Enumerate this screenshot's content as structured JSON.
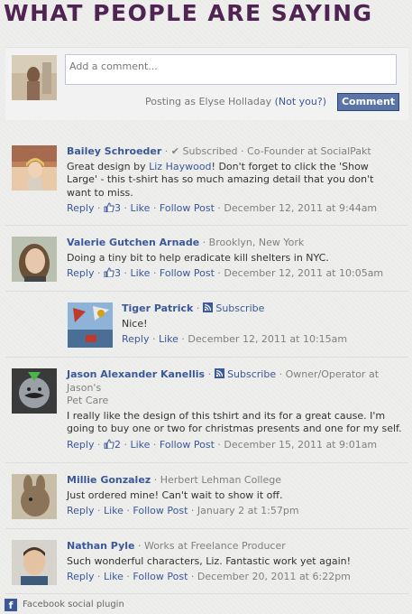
{
  "heading": "WHAT PEOPLE ARE SAYING",
  "composer": {
    "placeholder": "Add a comment...",
    "posting_as": "Posting as Elyse Holladay",
    "not_you": "(Not you?)",
    "button": "Comment"
  },
  "comments": [
    {
      "author": "Bailey Schroeder",
      "meta_prefix": " · ",
      "subscribed_label": "Subscribed",
      "meta": " · Co-Founder at SocialPakt",
      "text_before": "Great design by ",
      "text_link": "Liz Haywood",
      "text_after": "! Don't forget to click the 'Show Large' - this t-shirt has so much amazing detail that you don't want to miss.",
      "reply": "Reply",
      "likes": "3",
      "like": "Like",
      "follow": "Follow Post",
      "date": "December 12, 2011 at 9:44am"
    },
    {
      "author": "Valerie Gutchen Arnade",
      "meta": " · Brooklyn, New York",
      "text": "Doing a tiny bit to help eradicate kill shelters in NYC.",
      "reply": "Reply",
      "likes": "3",
      "like": "Like",
      "follow": "Follow Post",
      "date": "December 12, 2011 at 10:05am"
    },
    {
      "author": "Tiger Patrick",
      "subscribe": "Subscribe",
      "text": "Nice!",
      "reply": "Reply",
      "like": "Like",
      "date": "December 12, 2011 at 10:15am"
    },
    {
      "author": "Jason Alexander Kanellis",
      "subscribe": "Subscribe",
      "meta_line1": " · Owner/Operator at Jason's",
      "meta_line2": "Pet Care",
      "text": "I really like the design of this tshirt and its for a great cause. I'm going to buy one or two for christmas presents and one for my self.",
      "reply": "Reply",
      "likes": "2",
      "like": "Like",
      "follow": "Follow Post",
      "date": "December 15, 2011 at 9:01am"
    },
    {
      "author": "Millie Gonzalez",
      "meta": " · Herbert Lehman College",
      "text": "Just ordered mine! Can't wait to show it off.",
      "reply": "Reply",
      "like": "Like",
      "follow": "Follow Post",
      "date": "January 2 at 1:57pm"
    },
    {
      "author": "Nathan Pyle",
      "meta": " · Works at Freelance Producer",
      "text": "Such wonderful characters, Liz. Fantastic work yet again!",
      "reply": "Reply",
      "like": "Like",
      "follow": "Follow Post",
      "date": "December 20, 2011 at 6:22pm"
    }
  ],
  "footer": {
    "label": "Facebook social plugin",
    "icon_letter": "f"
  },
  "colors": {
    "heading": "#4f2452",
    "link": "#3b5998",
    "button": "#5b74a8"
  }
}
